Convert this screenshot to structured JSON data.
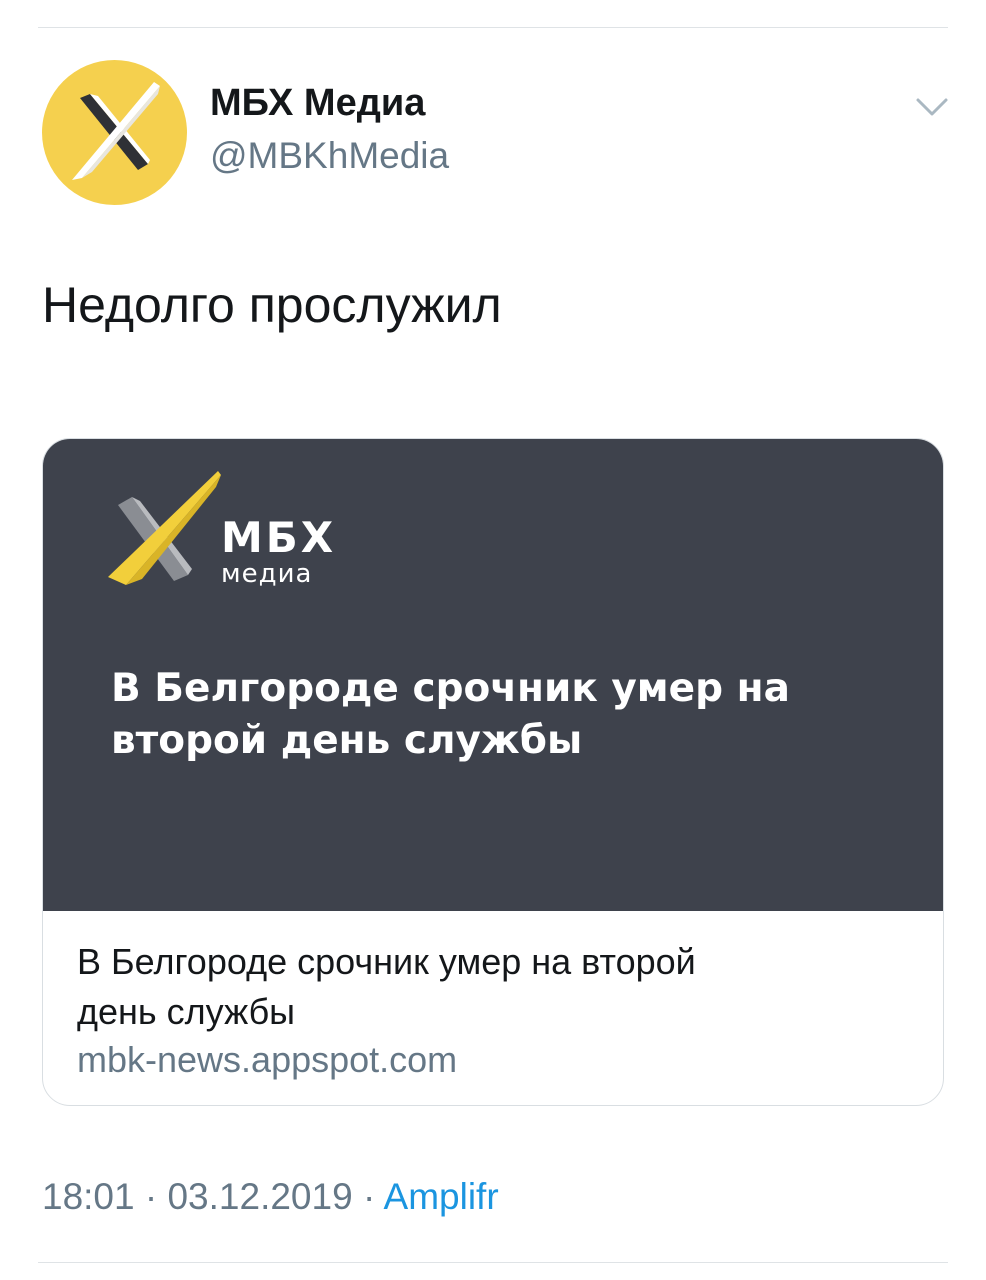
{
  "author": {
    "display_name": "МБХ Медиа",
    "handle": "@MBKhMedia"
  },
  "icons": {
    "avatar": "mbh-logo-icon",
    "menu": "chevron-down-icon"
  },
  "tweet": {
    "text": "Недолго прослужил"
  },
  "card": {
    "image": {
      "brand": "МБХ",
      "brand_sub": "медиа",
      "headline_line1": "В Белгороде срочник умер на",
      "headline_line2": "второй день службы"
    },
    "title_line1": "В Белгороде срочник умер на второй",
    "title_line2": "день службы",
    "domain": "mbk-news.appspot.com"
  },
  "meta": {
    "time": "18:01",
    "separator": "·",
    "date": "03.12.2019",
    "source": "Amplifr"
  },
  "colors": {
    "avatar_bg": "#f5d04e",
    "card_image_bg": "#3e424c",
    "secondary_text": "#657786",
    "link": "#1b95e0",
    "primary_text": "#14171a"
  }
}
